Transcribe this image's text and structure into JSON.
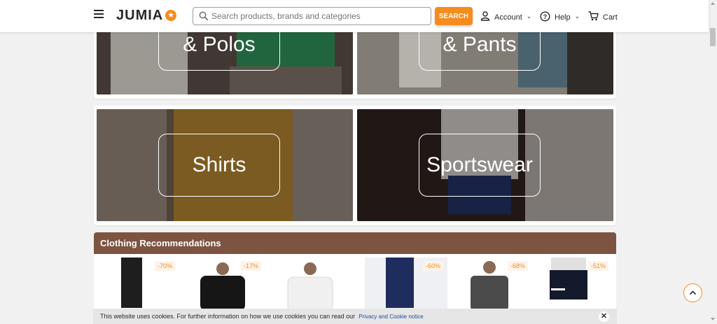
{
  "header": {
    "logo_text": "JUMIA",
    "logo_star": "★",
    "search_placeholder": "Search products, brands and categories",
    "search_button": "SEARCH",
    "account_label": "Account",
    "help_label": "Help",
    "cart_label": "Cart",
    "chevron": "⌄"
  },
  "categories": {
    "row1": [
      "T-Shirts\n& Polos",
      "Jeans\n& Pants"
    ],
    "row2": [
      "Shirts",
      "Sportswear"
    ]
  },
  "recommendations": {
    "title": "Clothing Recommendations",
    "products": [
      {
        "discount": "-70%"
      },
      {
        "discount": "-17%"
      },
      {
        "discount": ""
      },
      {
        "discount": "-60%"
      },
      {
        "discount": "-68%"
      },
      {
        "discount": "-51%"
      }
    ]
  },
  "cookie": {
    "text": "This website uses cookies. For further information on how we use cookies you can read our",
    "link": "Privacy and Cookie notice",
    "close": "✕"
  },
  "colors": {
    "accent": "#f68b1e",
    "rec_header": "#7d5442"
  },
  "icons": [
    "menu-icon",
    "search-icon",
    "account-icon",
    "help-icon",
    "cart-icon",
    "close-icon",
    "chevron-up-icon"
  ]
}
